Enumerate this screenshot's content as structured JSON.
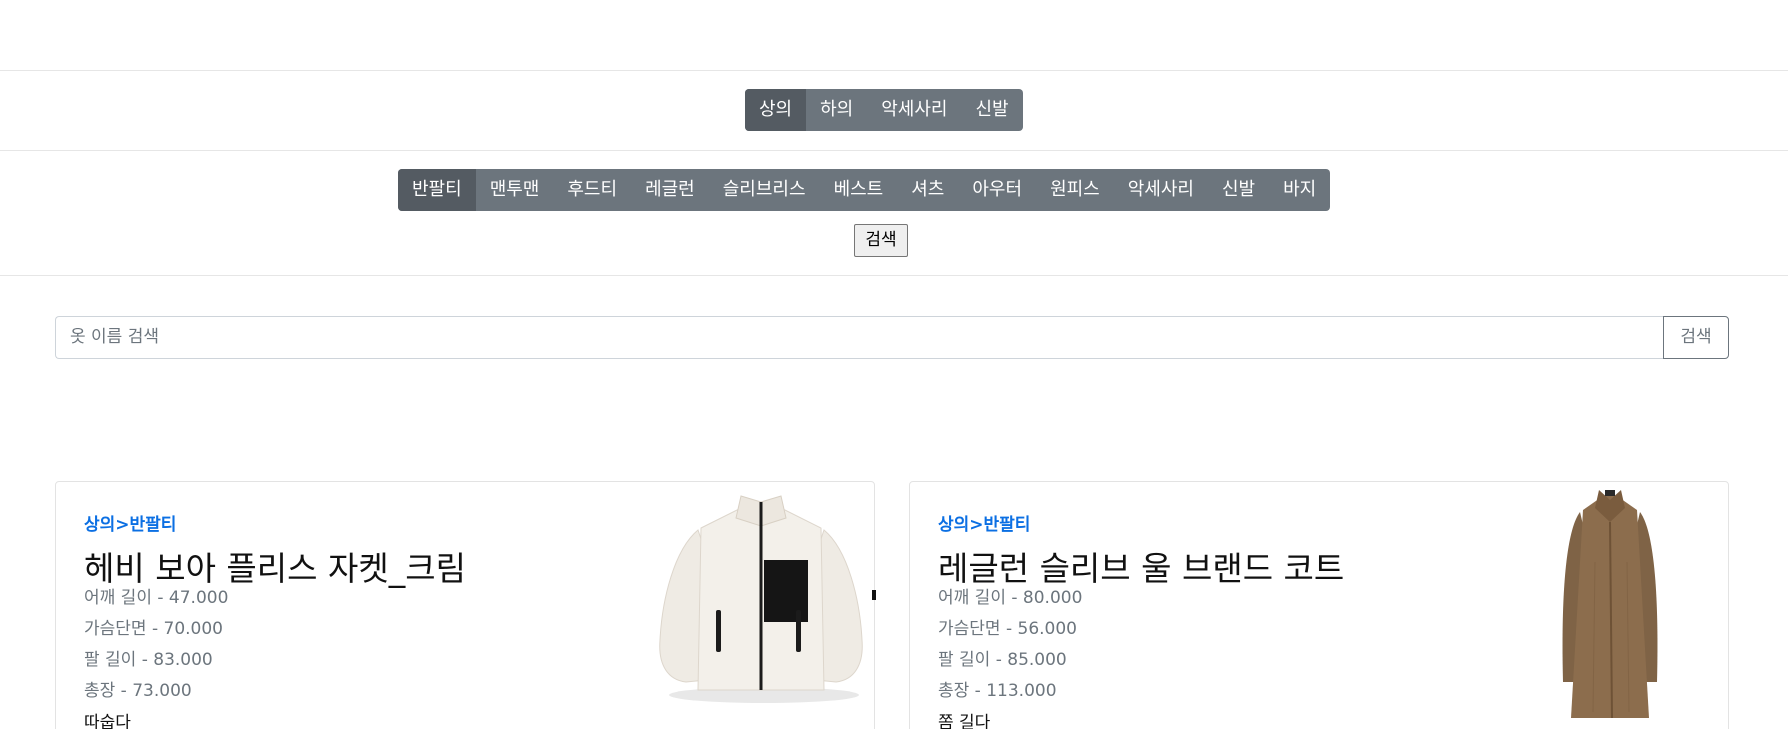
{
  "main_categories": [
    {
      "label": "상의",
      "active": true
    },
    {
      "label": "하의",
      "active": false
    },
    {
      "label": "악세사리",
      "active": false
    },
    {
      "label": "신발",
      "active": false
    }
  ],
  "sub_categories": [
    {
      "label": "반팔티",
      "active": true
    },
    {
      "label": "맨투맨",
      "active": false
    },
    {
      "label": "후드티",
      "active": false
    },
    {
      "label": "레글런",
      "active": false
    },
    {
      "label": "슬리브리스",
      "active": false
    },
    {
      "label": "베스트",
      "active": false
    },
    {
      "label": "셔츠",
      "active": false
    },
    {
      "label": "아우터",
      "active": false
    },
    {
      "label": "원피스",
      "active": false
    },
    {
      "label": "악세사리",
      "active": false
    },
    {
      "label": "신발",
      "active": false
    },
    {
      "label": "바지",
      "active": false
    }
  ],
  "filter_button_label": "검색",
  "search": {
    "placeholder": "옷 이름 검색",
    "value": "",
    "button_label": "검색"
  },
  "products": [
    {
      "breadcrumb": "상의>반팔티",
      "name": "헤비 보아 플리스 자켓_크림",
      "specs": [
        "어깨 길이 - 47.000",
        "가슴단면 - 70.000",
        "팔 길이 - 83.000",
        "총장 - 73.000"
      ],
      "note": "따숩다",
      "image_icon": "fleece-jacket-image"
    },
    {
      "breadcrumb": "상의>반팔티",
      "name": "레글런 슬리브 울 브랜드 코트",
      "specs": [
        "어깨 길이 - 80.000",
        "가슴단면 - 56.000",
        "팔 길이 - 85.000",
        "총장 - 113.000"
      ],
      "note": "쫌 길다",
      "image_icon": "wool-coat-image"
    }
  ],
  "colors": {
    "group_bg": "#6c757d",
    "group_active": "#545b62",
    "link_blue": "#0b6fe3"
  }
}
